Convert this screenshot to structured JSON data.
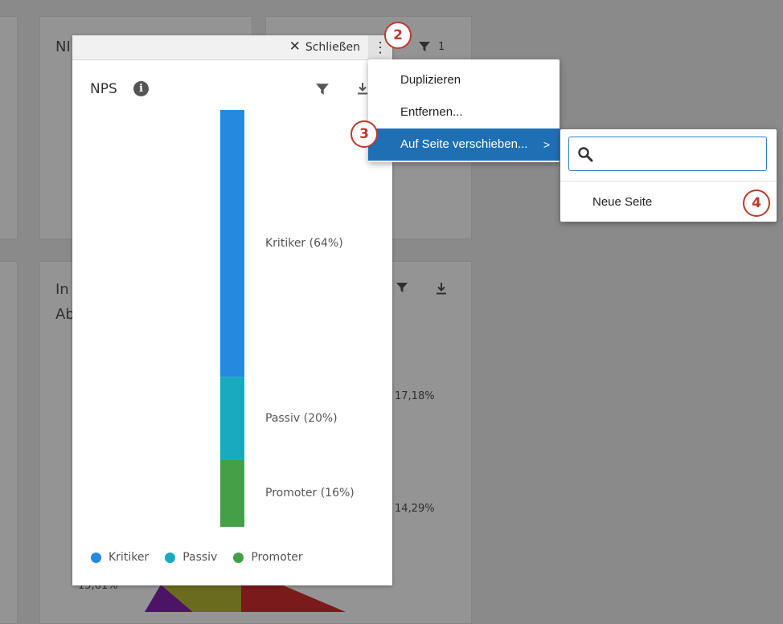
{
  "background": {
    "card1_title_partial": "NI",
    "card2_filter_count": "1",
    "card3_title_line1_partial": "In",
    "card3_title_line2_partial": "Ab",
    "pct_a": "17,18%",
    "pct_b": "14,29%",
    "pct_c": "15,61%"
  },
  "widget": {
    "close_label": "Schließen",
    "kebab_glyph": "⋮",
    "title": "NPS",
    "info_glyph": "i"
  },
  "chart_data": {
    "type": "bar",
    "stacked": true,
    "categories": [
      "NPS"
    ],
    "series": [
      {
        "name": "Kritiker",
        "values": [
          64
        ],
        "color": "#2589e0"
      },
      {
        "name": "Passiv",
        "values": [
          20
        ],
        "color": "#19aabf"
      },
      {
        "name": "Promoter",
        "values": [
          16
        ],
        "color": "#43a047"
      }
    ],
    "data_labels": [
      "Kritiker (64%)",
      "Passiv (20%)",
      "Promoter (16%)"
    ],
    "legend": [
      "Kritiker",
      "Passiv",
      "Promoter"
    ],
    "legend_placement": "bottom"
  },
  "menu": {
    "items": [
      {
        "label": "Duplizieren"
      },
      {
        "label": "Entfernen..."
      },
      {
        "label": "Auf Seite verschieben...",
        "chevron": ">"
      }
    ]
  },
  "submenu": {
    "search_value": "",
    "new_page_label": "Neue Seite"
  },
  "badges": [
    "2",
    "3",
    "4"
  ],
  "colors": {
    "accent": "#1f6fb5",
    "badge": "#c0392b"
  }
}
